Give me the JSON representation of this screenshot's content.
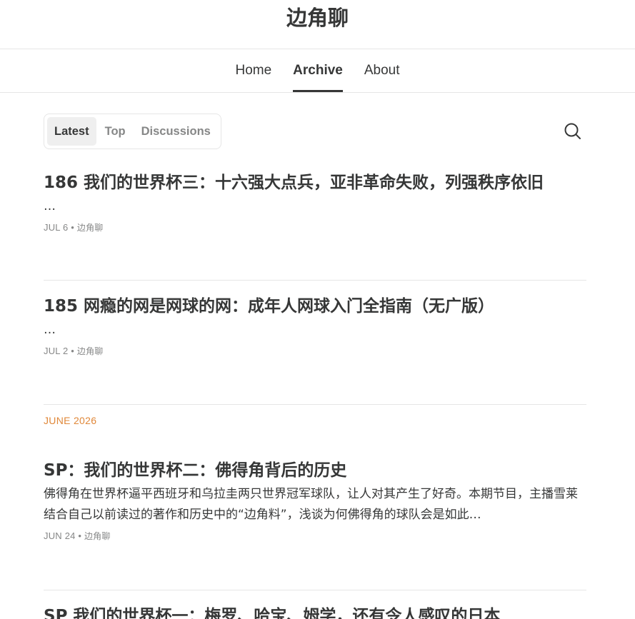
{
  "site": {
    "title": "边角聊"
  },
  "nav": {
    "items": [
      "Home",
      "Archive",
      "About"
    ]
  },
  "tabs": [
    "Latest",
    "Top",
    "Discussions"
  ],
  "posts": [
    {
      "title": "186 我们的世界杯三：十六强大点兵，亚非革命失败，列强秩序依旧",
      "desc": "…",
      "date": "JUL 6",
      "author": "边角聊"
    },
    {
      "title": "185 网瘾的网是网球的网：成年人网球入门全指南（无广版）",
      "desc": "…",
      "date": "JUL 2",
      "author": "边角聊"
    },
    {
      "title": "SP：我们的世界杯二：佛得角背后的历史",
      "desc": "佛得角在世界杯逼平西班牙和乌拉圭两只世界冠军球队，让人对其产生了好奇。本期节目，主播雪莱结合自己以前读过的著作和历史中的“边角料”，浅谈为何佛得角的球队会是如此…",
      "date": "JUN 24",
      "author": "边角聊"
    },
    {
      "title": "SP 我们的世界杯一：梅罗、哈宝、姆学，还有令人感叹的日本",
      "desc": "",
      "date": "",
      "author": ""
    }
  ],
  "month_header": "JUNE 2026",
  "meta_separator": "•",
  "icons": {
    "search": "search-icon"
  },
  "colors": {
    "text": "#363737",
    "muted": "#868787",
    "accent": "#e0883a",
    "border": "#e6e6e6"
  }
}
